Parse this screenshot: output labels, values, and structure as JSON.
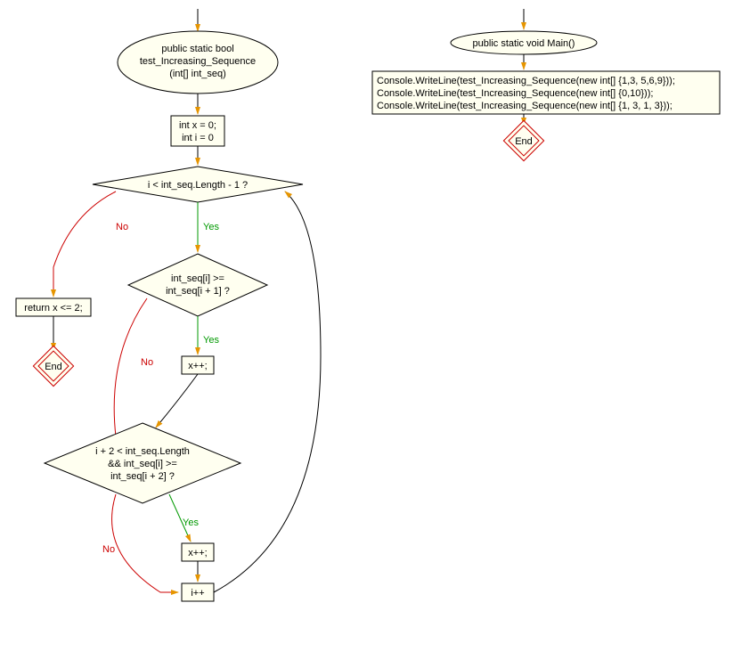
{
  "left_flow": {
    "start": {
      "line1": "public static bool",
      "line2": "test_Increasing_Sequence",
      "line3": "(int[] int_seq)"
    },
    "init": {
      "line1": "int x = 0;",
      "line2": "int i = 0"
    },
    "cond1": "i < int_seq.Length - 1 ?",
    "return": "return x <= 2;",
    "end1": "End",
    "cond2": {
      "line1": "int_seq[i] >=",
      "line2": "int_seq[i + 1] ?"
    },
    "inc1": "x++;",
    "cond3": {
      "line1": "i + 2 < int_seq.Length",
      "line2": "&& int_seq[i] >=",
      "line3": "int_seq[i + 2] ?"
    },
    "inc2": "x++;",
    "inc3": "i++",
    "labels": {
      "yes": "Yes",
      "no": "No"
    }
  },
  "right_flow": {
    "start": "public static void Main()",
    "body": {
      "line1": "Console.WriteLine(test_Increasing_Sequence(new int[] {1,3, 5,6,9}));",
      "line2": "Console.WriteLine(test_Increasing_Sequence(new int[] {0,10}));",
      "line3": "Console.WriteLine(test_Increasing_Sequence(new int[] {1, 3, 1, 3}));"
    },
    "end": "End"
  }
}
